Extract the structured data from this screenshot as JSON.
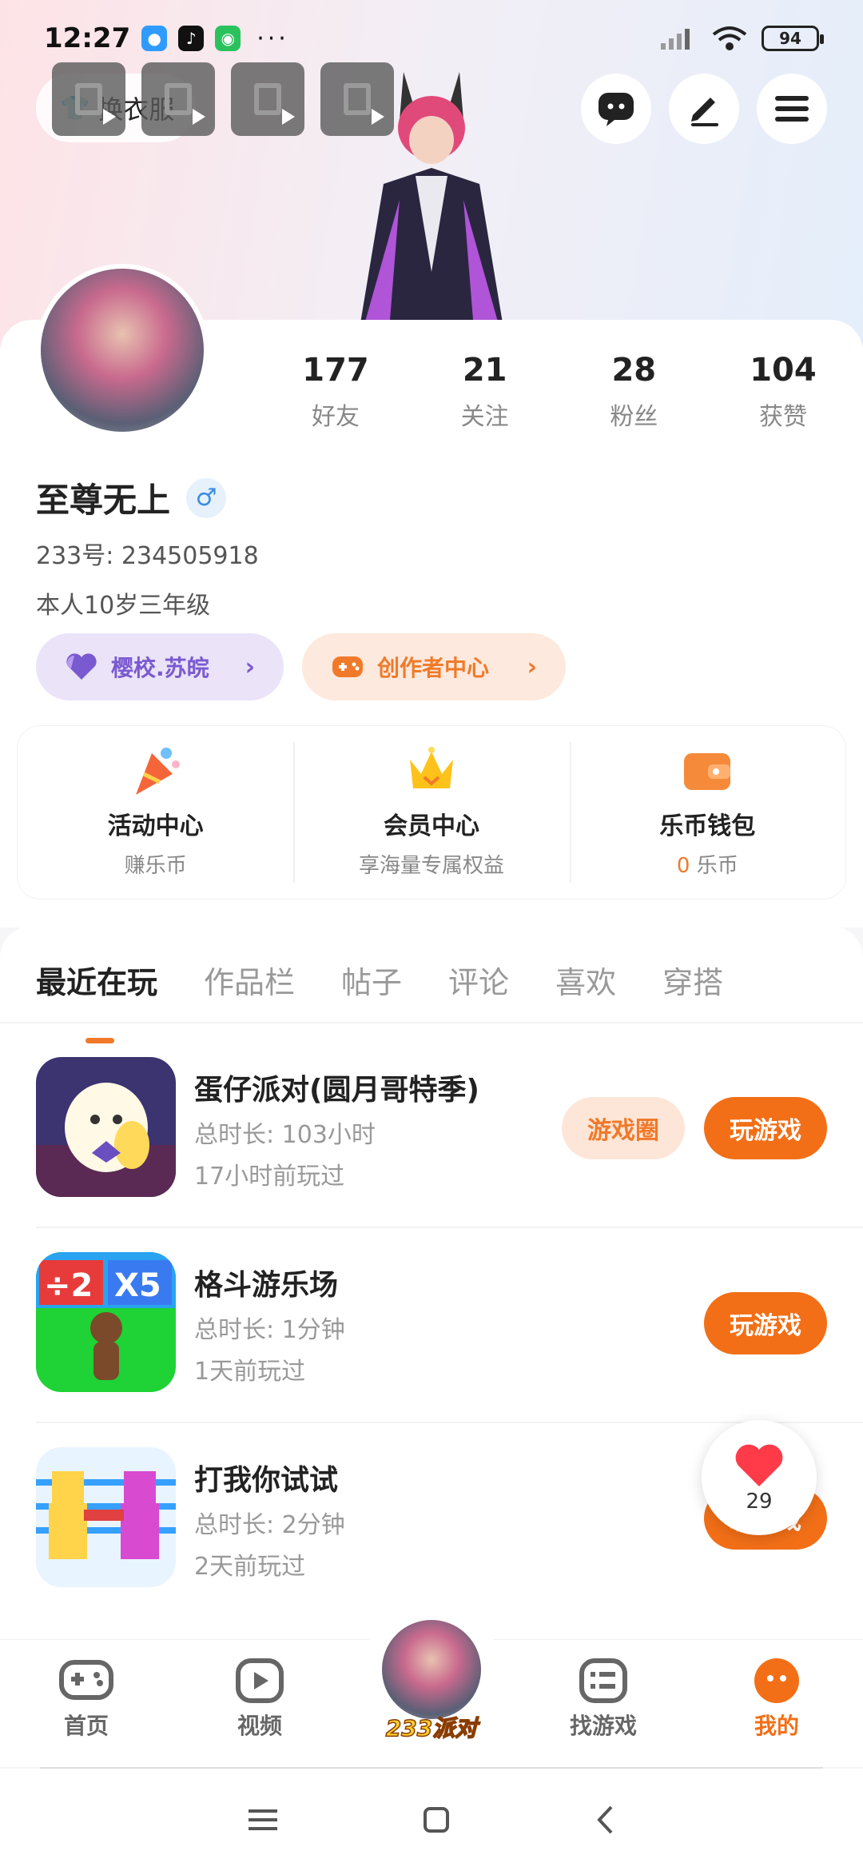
{
  "status_bar": {
    "time": "12:27",
    "battery": "94",
    "more": "···"
  },
  "hero": {
    "outfit_label": "换衣服"
  },
  "profile": {
    "stats": [
      {
        "value": "177",
        "label": "好友"
      },
      {
        "value": "21",
        "label": "关注"
      },
      {
        "value": "28",
        "label": "粉丝"
      },
      {
        "value": "104",
        "label": "获赞"
      }
    ],
    "name": "至尊无上",
    "gender_symbol": "♂",
    "uid": "233号: 234505918",
    "bio": "本人10岁三年级",
    "school_tag": "樱校.苏皖",
    "creator_tag": "创作者中心"
  },
  "services": [
    {
      "title": "活动中心",
      "subtitle": "赚乐币",
      "icon": "party-popper-icon"
    },
    {
      "title": "会员中心",
      "subtitle": "享海量专属权益",
      "icon": "crown-icon"
    },
    {
      "title": "乐币钱包",
      "subtitle_num": "0",
      "subtitle_unit": " 乐币",
      "icon": "wallet-icon"
    }
  ],
  "tabs": [
    "最近在玩",
    "作品栏",
    "帖子",
    "评论",
    "喜欢",
    "穿搭"
  ],
  "games": [
    {
      "title": "蛋仔派对(圆月哥特季)",
      "duration": "总时长: 103小时",
      "last_played": "17小时前玩过",
      "circle_btn": "游戏圈",
      "play_btn": "玩游戏"
    },
    {
      "title": "格斗游乐场",
      "duration": "总时长: 1分钟",
      "last_played": "1天前玩过",
      "play_btn": "玩游戏"
    },
    {
      "title": "打我你试试",
      "duration": "总时长: 2分钟",
      "last_played": "2天前玩过",
      "play_btn": "玩游戏"
    }
  ],
  "like_badge": {
    "count": "29"
  },
  "bottom_nav": {
    "home": "首页",
    "video": "视频",
    "party": "233派对",
    "find": "找游戏",
    "mine": "我的"
  },
  "colors": {
    "accent": "#f26f17",
    "purple_tag": "#7a5ad0"
  }
}
